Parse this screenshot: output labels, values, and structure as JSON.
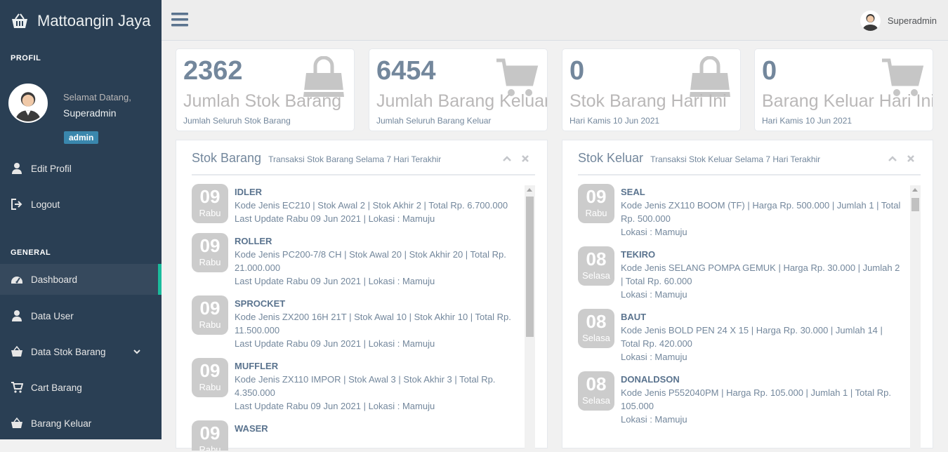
{
  "app": {
    "title": "Mattoangin Jaya"
  },
  "sidebar": {
    "profile_section": "PROFIL",
    "welcome": "Selamat Datang,",
    "username": "Superadmin",
    "role": "admin",
    "profile_items": [
      {
        "label": "Edit Profil",
        "icon": "user-icon"
      },
      {
        "label": "Logout",
        "icon": "logout-icon"
      }
    ],
    "general_section": "GENERAL",
    "general_items": [
      {
        "label": "Dashboard",
        "icon": "dashboard-icon",
        "active": true
      },
      {
        "label": "Data User",
        "icon": "user-icon"
      },
      {
        "label": "Data Stok Barang",
        "icon": "basket-icon",
        "has_submenu": true
      },
      {
        "label": "Cart Barang",
        "icon": "cart-icon"
      },
      {
        "label": "Barang Keluar",
        "icon": "basket-icon"
      }
    ]
  },
  "topbar": {
    "user": "Superadmin"
  },
  "tiles": [
    {
      "count": "2362",
      "title": "Jumlah Stok Barang",
      "sub": "Jumlah Seluruh Stok Barang",
      "icon": "shopping-bag-icon"
    },
    {
      "count": "6454",
      "title": "Jumlah Barang Keluar",
      "sub": "Jumlah Seluruh Barang Keluar",
      "icon": "cart-icon"
    },
    {
      "count": "0",
      "title": "Stok Barang Hari Ini",
      "sub": "Hari Kamis 10 Jun 2021",
      "icon": "shopping-bag-icon"
    },
    {
      "count": "0",
      "title": "Barang Keluar Hari Ini",
      "sub": "Hari Kamis 10 Jun 2021",
      "icon": "cart-icon"
    }
  ],
  "stok_panel": {
    "title": "Stok Barang",
    "subtitle": "Transaksi Stok Barang Selama 7 Hari Terakhir",
    "items": [
      {
        "day": "09",
        "weekday": "Rabu",
        "name": "IDLER",
        "detail": "Kode Jenis EC210 | Stok Awal 2 | Stok Akhir 2 | Total Rp. 6.700.000",
        "update": "Last Update Rabu 09 Jun 2021 | Lokasi : Mamuju"
      },
      {
        "day": "09",
        "weekday": "Rabu",
        "name": "ROLLER",
        "detail": "Kode Jenis PC200-7/8 CH | Stok Awal 20 | Stok Akhir 20 | Total Rp. 21.000.000",
        "update": "Last Update Rabu 09 Jun 2021 | Lokasi : Mamuju"
      },
      {
        "day": "09",
        "weekday": "Rabu",
        "name": "SPROCKET",
        "detail": "Kode Jenis ZX200 16H 21T | Stok Awal 10 | Stok Akhir 10 | Total Rp. 11.500.000",
        "update": "Last Update Rabu 09 Jun 2021 | Lokasi : Mamuju"
      },
      {
        "day": "09",
        "weekday": "Rabu",
        "name": "MUFFLER",
        "detail": "Kode Jenis ZX110 IMPOR | Stok Awal 3 | Stok Akhir 3 | Total Rp. 4.350.000",
        "update": "Last Update Rabu 09 Jun 2021 | Lokasi : Mamuju"
      },
      {
        "day": "09",
        "weekday": "Rabu",
        "name": "WASER",
        "detail": "",
        "update": ""
      }
    ]
  },
  "keluar_panel": {
    "title": "Stok Keluar",
    "subtitle": "Transaksi Stok Keluar Selama 7 Hari Terakhir",
    "items": [
      {
        "day": "09",
        "weekday": "Rabu",
        "name": "SEAL",
        "detail": "Kode Jenis ZX110 BOOM (TF) | Harga Rp. 500.000 | Jumlah 1 | Total Rp. 500.000",
        "update": "Lokasi : Mamuju"
      },
      {
        "day": "08",
        "weekday": "Selasa",
        "name": "TEKIRO",
        "detail": "Kode Jenis SELANG POMPA GEMUK | Harga Rp. 30.000 | Jumlah 2 | Total Rp. 60.000",
        "update": "Lokasi : Mamuju"
      },
      {
        "day": "08",
        "weekday": "Selasa",
        "name": "BAUT",
        "detail": "Kode Jenis BOLD PEN 24 X 15 | Harga Rp. 30.000 | Jumlah 14 | Total Rp. 420.000",
        "update": "Lokasi : Mamuju"
      },
      {
        "day": "08",
        "weekday": "Selasa",
        "name": "DONALDSON",
        "detail": "Kode Jenis P552040PM | Harga Rp. 105.000 | Jumlah 1 | Total Rp. 105.000",
        "update": "Lokasi : Mamuju"
      }
    ]
  }
}
